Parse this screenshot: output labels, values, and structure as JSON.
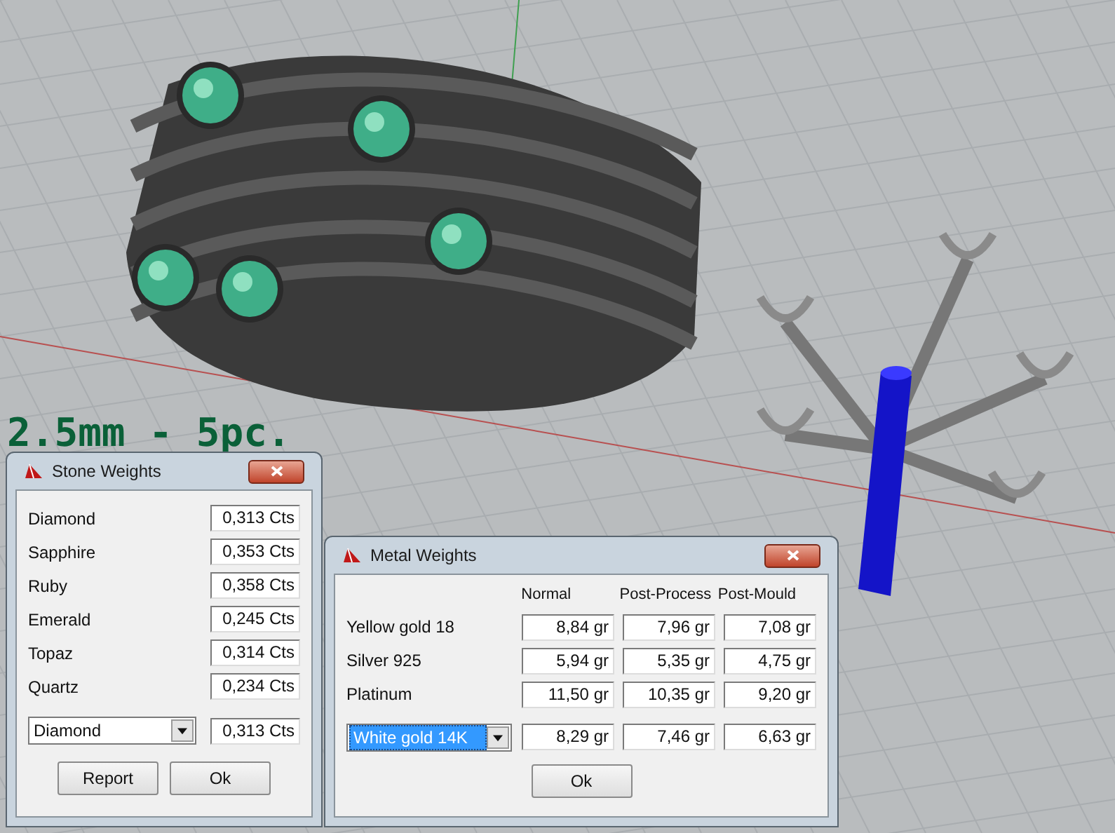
{
  "viewport": {
    "label": "2.5mm - 5pc."
  },
  "stone_weights": {
    "title": "Stone Weights",
    "rows": [
      {
        "label": "Diamond",
        "value": "0,313 Cts"
      },
      {
        "label": "Sapphire",
        "value": "0,353 Cts"
      },
      {
        "label": "Ruby",
        "value": "0,358 Cts"
      },
      {
        "label": "Emerald",
        "value": "0,245 Cts"
      },
      {
        "label": "Topaz",
        "value": "0,314 Cts"
      },
      {
        "label": "Quartz",
        "value": "0,234 Cts"
      }
    ],
    "select": {
      "value": "Diamond",
      "focused": false
    },
    "selected_weight": "0,313 Cts",
    "buttons": [
      "Report",
      "Ok"
    ]
  },
  "metal_weights": {
    "title": "Metal Weights",
    "columns": [
      "Normal",
      "Post-Process",
      "Post-Mould"
    ],
    "rows": [
      {
        "label": "Yellow gold 18",
        "values": [
          "8,84 gr",
          "7,96 gr",
          "7,08 gr"
        ]
      },
      {
        "label": "Silver 925",
        "values": [
          "5,94 gr",
          "5,35 gr",
          "4,75 gr"
        ]
      },
      {
        "label": "Platinum",
        "values": [
          "11,50 gr",
          "10,35 gr",
          "9,20 gr"
        ]
      }
    ],
    "select": {
      "value": "White gold 14K",
      "focused": true
    },
    "selected_values": [
      "8,29 gr",
      "7,46 gr",
      "6,63 gr"
    ],
    "buttons": [
      "Ok"
    ]
  }
}
